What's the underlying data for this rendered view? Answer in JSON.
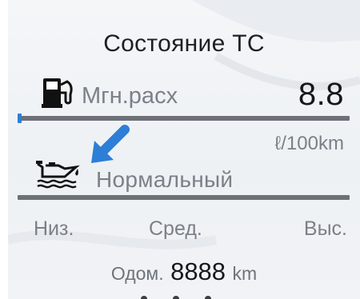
{
  "header": {
    "title": "Состояние ТС"
  },
  "fuel": {
    "icon": "fuel-pump-icon",
    "label": "Мгн.расх",
    "value": "8.8",
    "unit": "ℓ/100km",
    "level": 0.01
  },
  "oil": {
    "icon": "oil-can-icon",
    "pointer_icon": "arrow-down-left-icon",
    "status": "Нормальный",
    "level": 0.0
  },
  "scale": {
    "low": "Низ.",
    "mid": "Сред.",
    "high": "Выс."
  },
  "odometer": {
    "label": "Одом.",
    "value": "8888",
    "unit": "km"
  },
  "colors": {
    "accent": "#2d7ed6",
    "track": "#6c7077",
    "text_primary": "#15171a",
    "text_secondary": "#7b8089"
  }
}
